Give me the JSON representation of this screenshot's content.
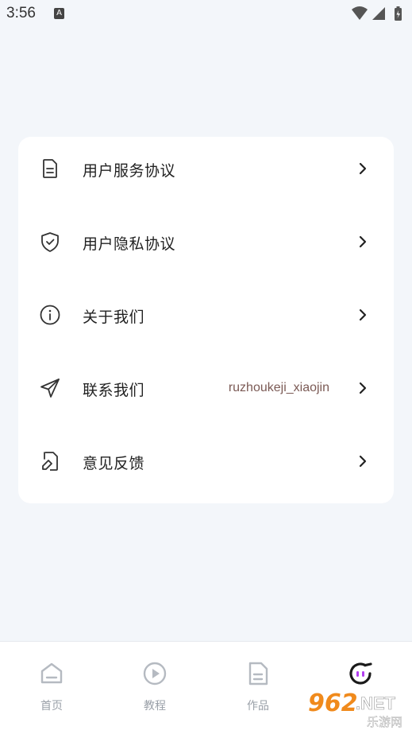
{
  "status_bar": {
    "time": "3:56",
    "notification_icon": "a-notification-icon",
    "wifi_icon": "wifi-icon",
    "signal_icon": "signal-icon",
    "battery_icon": "battery-icon"
  },
  "menu": {
    "items": [
      {
        "label": "用户服务协议",
        "value": "",
        "icon": "document-icon"
      },
      {
        "label": "用户隐私协议",
        "value": "",
        "icon": "shield-check-icon"
      },
      {
        "label": "关于我们",
        "value": "",
        "icon": "info-icon"
      },
      {
        "label": "联系我们",
        "value": "ruzhoukeji_xiaojin",
        "icon": "send-icon"
      },
      {
        "label": "意见反馈",
        "value": "",
        "icon": "feedback-edit-icon"
      }
    ]
  },
  "tabbar": {
    "tabs": [
      {
        "label": "首页",
        "icon": "home-icon",
        "active": false
      },
      {
        "label": "教程",
        "icon": "play-circle-icon",
        "active": false
      },
      {
        "label": "作品",
        "icon": "file-icon",
        "active": false
      },
      {
        "label": "",
        "icon": "profile-face-icon",
        "active": true
      }
    ]
  },
  "watermark": {
    "text_top": "962.NET",
    "text_bottom": "乐游网"
  },
  "colors": {
    "background": "#f3f6fa",
    "card": "#ffffff",
    "accent_purple": "#b23ef0",
    "contact_value": "#7b5a55",
    "tab_inactive": "#9aa0a8"
  }
}
